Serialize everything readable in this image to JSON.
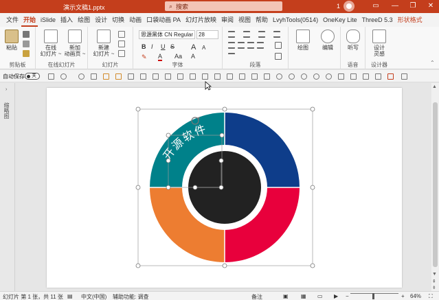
{
  "window": {
    "title": "演示文稿1.pptx",
    "search_placeholder": "搜索",
    "user_badge": "1",
    "minimize": "—",
    "restore": "❐",
    "close": "✕"
  },
  "tabs": [
    {
      "label": "文件"
    },
    {
      "label": "开始"
    },
    {
      "label": "iSlide"
    },
    {
      "label": "插入"
    },
    {
      "label": "绘图"
    },
    {
      "label": "设计"
    },
    {
      "label": "切换"
    },
    {
      "label": "动画"
    },
    {
      "label": "口袋动画 PA"
    },
    {
      "label": "幻灯片放映"
    },
    {
      "label": "审阅"
    },
    {
      "label": "视图"
    },
    {
      "label": "帮助"
    },
    {
      "label": "LvyhTools(0514)"
    },
    {
      "label": "OneKey Lite"
    },
    {
      "label": "ThreeD 5.3"
    },
    {
      "label": "形状格式"
    }
  ],
  "ribbon": {
    "clipboard": {
      "paste": "粘贴",
      "label": "剪贴板"
    },
    "online_slides": {
      "btn1_line1": "在线",
      "btn1_line2": "幻灯片 ~",
      "btn2_line1": "新加",
      "btn2_line2": "动画页 ~",
      "label": "在线幻灯片"
    },
    "slides": {
      "new_line1": "新建",
      "new_line2": "幻灯片 ~",
      "label": "幻灯片"
    },
    "font": {
      "family": "思源黑体 CN Regular",
      "size": "28",
      "label": "字体",
      "bold": "B",
      "italic": "I",
      "underline": "U",
      "strike": "S",
      "grow": "A",
      "shrink": "A",
      "case": "Aa",
      "clear": "A"
    },
    "paragraph": {
      "label": "段落"
    },
    "drawing": {
      "btn": "绘图"
    },
    "editing": {
      "btn": "编辑"
    },
    "voice": {
      "btn": "听写",
      "label": "语音"
    },
    "designer": {
      "btn_line1": "设计",
      "btn_line2": "灵感",
      "label": "设计器"
    }
  },
  "qat": {
    "autosave": "自动保存",
    "toggle": "关"
  },
  "leftpane": {
    "label": "缩略图",
    "arrow": "›"
  },
  "diagram": {
    "arc_text": "开源软件",
    "colors": {
      "teal": "#00818a",
      "blue": "#0e3d8a",
      "red": "#e8003c",
      "orange": "#ed7d31",
      "center": "#222222",
      "ring": "#ffffff"
    }
  },
  "status": {
    "slide_info": "幻灯片 第 1 张，共 11 张",
    "language": "中文(中国)",
    "accessibility": "辅助功能: 调查",
    "notes": "备注",
    "zoom": "64%"
  }
}
